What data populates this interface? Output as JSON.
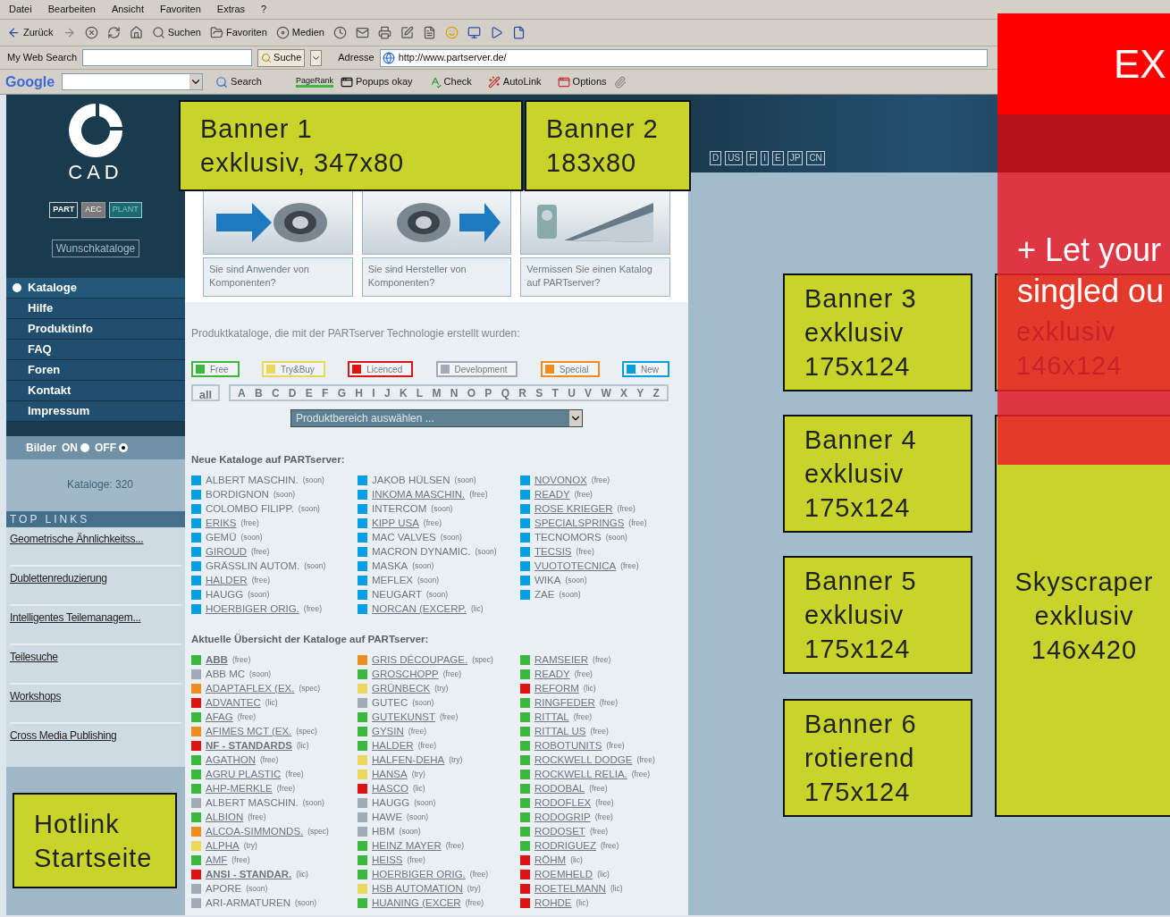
{
  "browser": {
    "menu": [
      "Datei",
      "Bearbeiten",
      "Ansicht",
      "Favoriten",
      "Extras",
      "?"
    ],
    "toolbar": [
      {
        "kind": "back",
        "label": "Zurück"
      },
      {
        "kind": "forward"
      },
      {
        "kind": "stop"
      },
      {
        "kind": "refresh"
      },
      {
        "kind": "home"
      },
      {
        "kind": "search",
        "label": "Suchen"
      },
      {
        "kind": "favorites",
        "label": "Favoriten"
      },
      {
        "kind": "media",
        "label": "Medien"
      },
      {
        "kind": "history"
      },
      {
        "kind": "mail"
      },
      {
        "kind": "print"
      },
      {
        "kind": "edit"
      },
      {
        "kind": "note"
      },
      {
        "kind": "messenger"
      },
      {
        "kind": "screen"
      },
      {
        "kind": "cursor"
      },
      {
        "kind": "file"
      }
    ],
    "search_label": "My Web Search",
    "search_button": "Suche",
    "address_label": "Adresse",
    "url": "http://www.partserver.de/",
    "google": {
      "logo": "Google",
      "search": "Search",
      "pagerank": "PageRank",
      "popups": "Popups okay",
      "check": "Check",
      "autolink": "AutoLink",
      "options": "Options"
    }
  },
  "sidebar": {
    "logo": "CAD",
    "segments": [
      {
        "label": "PART",
        "kind": "active"
      },
      {
        "label": "AEC",
        "kind": "inactive"
      },
      {
        "label": "PLANT",
        "kind": "teal"
      }
    ],
    "wish_button": "Wunschkataloge",
    "nav": [
      {
        "label": "Kataloge",
        "selected": true
      },
      {
        "label": "Hilfe",
        "selected": false
      },
      {
        "label": "Produktinfo",
        "selected": false
      },
      {
        "label": "FAQ",
        "selected": false
      },
      {
        "label": "Foren",
        "selected": false
      },
      {
        "label": "Kontakt",
        "selected": false
      },
      {
        "label": "Impressum",
        "selected": false
      }
    ],
    "images": {
      "label": "Bilder",
      "options": [
        {
          "label": "ON",
          "selected": false
        },
        {
          "label": "OFF",
          "selected": true
        }
      ]
    },
    "count": "Kataloge: 320",
    "top_links_title": "TOP LINKS",
    "top_links": [
      "Geometrische Ähnlichkeitss...",
      "Dublettenreduzierung",
      "Intelligentes Teilemanagem...",
      "Teilesuche",
      "Workshops",
      "Cross Media Publishing"
    ]
  },
  "content": {
    "audience": [
      "Sie sind Anwender von Komponenten?",
      "Sie sind Hersteller von Komponenten?",
      "Vermissen Sie einen Katalog auf PARTserver?"
    ],
    "intro": "Produktkataloge, die mit der PARTserver Technologie erstellt wurden:",
    "legend": [
      {
        "label": "Free",
        "color": "#3cb93c"
      },
      {
        "label": "Try&Buy",
        "color": "#ebd75a"
      },
      {
        "label": "Licenced",
        "color": "#dc1414"
      },
      {
        "label": "Development",
        "color": "#a0aab4"
      },
      {
        "label": "Special",
        "color": "#f08c1e"
      },
      {
        "label": "New",
        "color": "#00a0e0"
      }
    ],
    "all_button": "all",
    "letters": [
      "A",
      "B",
      "C",
      "D",
      "E",
      "F",
      "G",
      "H",
      "I",
      "J",
      "K",
      "L",
      "M",
      "N",
      "O",
      "P",
      "Q",
      "R",
      "S",
      "T",
      "U",
      "V",
      "W",
      "X",
      "Y",
      "Z"
    ],
    "category_select": {
      "placeholder": "Produktbereich auswählen ..."
    },
    "new_catalogs": {
      "title": "Neue Kataloge auf PARTserver:",
      "columns": [
        [
          {
            "name": "ALBERT MASCHIN.",
            "tag": "(soon)",
            "color": "#00a0e0",
            "link": false,
            "bold": false
          },
          {
            "name": "BORDIGNON",
            "tag": "(soon)",
            "color": "#00a0e0",
            "link": false,
            "bold": false
          },
          {
            "name": "COLOMBO FILIPP.",
            "tag": "(soon)",
            "color": "#00a0e0",
            "link": false,
            "bold": false
          },
          {
            "name": "ERIKS",
            "tag": "(free)",
            "color": "#00a0e0",
            "link": true,
            "bold": false
          },
          {
            "name": "GEMÜ",
            "tag": "(soon)",
            "color": "#00a0e0",
            "link": false,
            "bold": false
          },
          {
            "name": "GIROUD",
            "tag": "(free)",
            "color": "#00a0e0",
            "link": true,
            "bold": false
          },
          {
            "name": "GRÄSSLIN AUTOM.",
            "tag": "(soon)",
            "color": "#00a0e0",
            "link": false,
            "bold": false
          },
          {
            "name": "HALDER",
            "tag": "(free)",
            "color": "#00a0e0",
            "link": true,
            "bold": false
          },
          {
            "name": "HAUGG",
            "tag": "(soon)",
            "color": "#00a0e0",
            "link": false,
            "bold": false
          },
          {
            "name": "HOERBIGER ORIG.",
            "tag": "(free)",
            "color": "#00a0e0",
            "link": true,
            "bold": false
          }
        ],
        [
          {
            "name": "JAKOB HÜLSEN",
            "tag": "(soon)",
            "color": "#00a0e0",
            "link": false,
            "bold": false
          },
          {
            "name": "INKOMA MASCHIN.",
            "tag": "(free)",
            "color": "#00a0e0",
            "link": true,
            "bold": false
          },
          {
            "name": "INTERCOM",
            "tag": "(soon)",
            "color": "#00a0e0",
            "link": false,
            "bold": false
          },
          {
            "name": "KIPP USA",
            "tag": "(free)",
            "color": "#00a0e0",
            "link": true,
            "bold": false
          },
          {
            "name": "MAC VALVES",
            "tag": "(soon)",
            "color": "#00a0e0",
            "link": false,
            "bold": false
          },
          {
            "name": "MACRON DYNAMIC.",
            "tag": "(soon)",
            "color": "#00a0e0",
            "link": false,
            "bold": false
          },
          {
            "name": "MASKA",
            "tag": "(soon)",
            "color": "#00a0e0",
            "link": false,
            "bold": false
          },
          {
            "name": "MEFLEX",
            "tag": "(soon)",
            "color": "#00a0e0",
            "link": false,
            "bold": false
          },
          {
            "name": "NEUGART",
            "tag": "(soon)",
            "color": "#00a0e0",
            "link": false,
            "bold": false
          },
          {
            "name": "NORCAN (EXCERP.",
            "tag": "(lic)",
            "color": "#00a0e0",
            "link": true,
            "bold": false
          }
        ],
        [
          {
            "name": "NOVONOX",
            "tag": "(free)",
            "color": "#00a0e0",
            "link": true,
            "bold": false
          },
          {
            "name": "READY",
            "tag": "(free)",
            "color": "#00a0e0",
            "link": true,
            "bold": false
          },
          {
            "name": "ROSE KRIEGER",
            "tag": "(free)",
            "color": "#00a0e0",
            "link": true,
            "bold": false
          },
          {
            "name": "SPECIALSPRINGS",
            "tag": "(free)",
            "color": "#00a0e0",
            "link": true,
            "bold": false
          },
          {
            "name": "TECNOMORS",
            "tag": "(soon)",
            "color": "#00a0e0",
            "link": false,
            "bold": false
          },
          {
            "name": "TECSIS",
            "tag": "(free)",
            "color": "#00a0e0",
            "link": true,
            "bold": false
          },
          {
            "name": "VUOTOTECNICA",
            "tag": "(free)",
            "color": "#00a0e0",
            "link": true,
            "bold": false
          },
          {
            "name": "WIKA",
            "tag": "(soon)",
            "color": "#00a0e0",
            "link": false,
            "bold": false
          },
          {
            "name": "ZAE",
            "tag": "(soon)",
            "color": "#00a0e0",
            "link": false,
            "bold": false
          }
        ]
      ]
    },
    "overview": {
      "title": "Aktuelle Übersicht der Kataloge auf PARTserver:",
      "columns": [
        [
          {
            "name": "ABB",
            "tag": "(free)",
            "color": "#3cb93c",
            "link": true,
            "bold": true
          },
          {
            "name": "ABB MC",
            "tag": "(soon)",
            "color": "#a0aab4",
            "link": false,
            "bold": false
          },
          {
            "name": "ADAPTAFLEX (EX.",
            "tag": "(spec)",
            "color": "#f08c1e",
            "link": true,
            "bold": false
          },
          {
            "name": "ADVANTEC",
            "tag": "(lic)",
            "color": "#dc1414",
            "link": true,
            "bold": false
          },
          {
            "name": "AFAG",
            "tag": "(free)",
            "color": "#3cb93c",
            "link": true,
            "bold": false
          },
          {
            "name": "AFIMES MCT (EX.",
            "tag": "(spec)",
            "color": "#f08c1e",
            "link": true,
            "bold": false
          },
          {
            "name": "NF - STANDARDS",
            "tag": "(lic)",
            "color": "#dc1414",
            "link": true,
            "bold": true
          },
          {
            "name": "AGATHON",
            "tag": "(free)",
            "color": "#3cb93c",
            "link": true,
            "bold": false
          },
          {
            "name": "AGRU PLASTIC",
            "tag": "(free)",
            "color": "#3cb93c",
            "link": true,
            "bold": false
          },
          {
            "name": "AHP-MERKLE",
            "tag": "(free)",
            "color": "#3cb93c",
            "link": true,
            "bold": false
          },
          {
            "name": "ALBERT MASCHIN.",
            "tag": "(soon)",
            "color": "#a0aab4",
            "link": false,
            "bold": false
          },
          {
            "name": "ALBION",
            "tag": "(free)",
            "color": "#3cb93c",
            "link": true,
            "bold": false
          },
          {
            "name": "ALCOA-SIMMONDS.",
            "tag": "(spec)",
            "color": "#f08c1e",
            "link": true,
            "bold": false
          },
          {
            "name": "ALPHA",
            "tag": "(try)",
            "color": "#ebd75a",
            "link": true,
            "bold": false
          },
          {
            "name": "AMF",
            "tag": "(free)",
            "color": "#3cb93c",
            "link": true,
            "bold": false
          },
          {
            "name": "ANSI - STANDAR.",
            "tag": "(lic)",
            "color": "#dc1414",
            "link": true,
            "bold": true
          },
          {
            "name": "APORE",
            "tag": "(soon)",
            "color": "#a0aab4",
            "link": false,
            "bold": false
          },
          {
            "name": "ARI-ARMATUREN",
            "tag": "(soon)",
            "color": "#a0aab4",
            "link": false,
            "bold": false
          }
        ],
        [
          {
            "name": "GRIS DÉCOUPAGE.",
            "tag": "(spec)",
            "color": "#f08c1e",
            "link": true,
            "bold": false
          },
          {
            "name": "GROSCHOPP",
            "tag": "(free)",
            "color": "#3cb93c",
            "link": true,
            "bold": false
          },
          {
            "name": "GRÜNBECK",
            "tag": "(try)",
            "color": "#ebd75a",
            "link": true,
            "bold": false
          },
          {
            "name": "GUTEC",
            "tag": "(soon)",
            "color": "#a0aab4",
            "link": false,
            "bold": false
          },
          {
            "name": "GUTEKUNST",
            "tag": "(free)",
            "color": "#3cb93c",
            "link": true,
            "bold": false
          },
          {
            "name": "GYSIN",
            "tag": "(free)",
            "color": "#3cb93c",
            "link": true,
            "bold": false
          },
          {
            "name": "HALDER",
            "tag": "(free)",
            "color": "#3cb93c",
            "link": true,
            "bold": false
          },
          {
            "name": "HALFEN-DEHA",
            "tag": "(try)",
            "color": "#ebd75a",
            "link": true,
            "bold": false
          },
          {
            "name": "HANSA",
            "tag": "(try)",
            "color": "#ebd75a",
            "link": true,
            "bold": false
          },
          {
            "name": "HASCO",
            "tag": "(lic)",
            "color": "#dc1414",
            "link": true,
            "bold": false
          },
          {
            "name": "HAUGG",
            "tag": "(soon)",
            "color": "#a0aab4",
            "link": false,
            "bold": false
          },
          {
            "name": "HAWE",
            "tag": "(soon)",
            "color": "#a0aab4",
            "link": false,
            "bold": false
          },
          {
            "name": "HBM",
            "tag": "(soon)",
            "color": "#a0aab4",
            "link": false,
            "bold": false
          },
          {
            "name": "HEINZ MAYER",
            "tag": "(free)",
            "color": "#3cb93c",
            "link": true,
            "bold": false
          },
          {
            "name": "HEISS",
            "tag": "(free)",
            "color": "#3cb93c",
            "link": true,
            "bold": false
          },
          {
            "name": "HOERBIGER ORIG.",
            "tag": "(free)",
            "color": "#3cb93c",
            "link": true,
            "bold": false
          },
          {
            "name": "HSB AUTOMATION",
            "tag": "(try)",
            "color": "#ebd75a",
            "link": true,
            "bold": false
          },
          {
            "name": "HUANING (EXCER",
            "tag": "(free)",
            "color": "#3cb93c",
            "link": true,
            "bold": false
          }
        ],
        [
          {
            "name": "RAMSEIER",
            "tag": "(free)",
            "color": "#3cb93c",
            "link": true,
            "bold": false
          },
          {
            "name": "READY",
            "tag": "(free)",
            "color": "#3cb93c",
            "link": true,
            "bold": false
          },
          {
            "name": "REFORM",
            "tag": "(lic)",
            "color": "#dc1414",
            "link": true,
            "bold": false
          },
          {
            "name": "RINGFEDER",
            "tag": "(free)",
            "color": "#3cb93c",
            "link": true,
            "bold": false
          },
          {
            "name": "RITTAL",
            "tag": "(free)",
            "color": "#3cb93c",
            "link": true,
            "bold": false
          },
          {
            "name": "RITTAL US",
            "tag": "(free)",
            "color": "#3cb93c",
            "link": true,
            "bold": false
          },
          {
            "name": "ROBOTUNITS",
            "tag": "(free)",
            "color": "#3cb93c",
            "link": true,
            "bold": false
          },
          {
            "name": "ROCKWELL DODGE",
            "tag": "(free)",
            "color": "#3cb93c",
            "link": true,
            "bold": false
          },
          {
            "name": "ROCKWELL RELIA.",
            "tag": "(free)",
            "color": "#3cb93c",
            "link": true,
            "bold": false
          },
          {
            "name": "RODOBAL",
            "tag": "(free)",
            "color": "#3cb93c",
            "link": true,
            "bold": false
          },
          {
            "name": "RODOFLEX",
            "tag": "(free)",
            "color": "#3cb93c",
            "link": true,
            "bold": false
          },
          {
            "name": "RODOGRIP",
            "tag": "(free)",
            "color": "#3cb93c",
            "link": true,
            "bold": false
          },
          {
            "name": "RODOSET",
            "tag": "(free)",
            "color": "#3cb93c",
            "link": true,
            "bold": false
          },
          {
            "name": "RODRIGUEZ",
            "tag": "(free)",
            "color": "#3cb93c",
            "link": true,
            "bold": false
          },
          {
            "name": "RÖHM",
            "tag": "(lic)",
            "color": "#dc1414",
            "link": true,
            "bold": false
          },
          {
            "name": "ROEMHELD",
            "tag": "(lic)",
            "color": "#dc1414",
            "link": true,
            "bold": false
          },
          {
            "name": "ROETELMANN",
            "tag": "(lic)",
            "color": "#dc1414",
            "link": true,
            "bold": false
          },
          {
            "name": "ROHDE",
            "tag": "(lic)",
            "color": "#dc1414",
            "link": true,
            "bold": false
          }
        ]
      ]
    }
  },
  "languages": [
    "D",
    "US",
    "F",
    "I",
    "E",
    "JP",
    "CN"
  ],
  "banners": [
    {
      "lines": [
        "Banner 1",
        "exklusiv, 347x80"
      ]
    },
    {
      "lines": [
        "Banner 2",
        "183x80"
      ]
    },
    {
      "lines": [
        "Banner 3",
        "exklusiv",
        "175x124"
      ]
    },
    {
      "lines": [
        "Banner 4",
        "exklusiv",
        "175x124"
      ]
    },
    {
      "lines": [
        "Banner 5",
        "exklusiv",
        "175x124"
      ]
    },
    {
      "lines": [
        "Banner 6",
        "rotierend",
        "175x124"
      ]
    },
    {
      "lines": [
        "exklusiv",
        "146x124"
      ]
    },
    {
      "lines": [
        "Skyscraper",
        "exklusiv",
        "146x420"
      ]
    },
    {
      "lines": [
        "Hotlink",
        "Startseite"
      ]
    }
  ],
  "overlay": {
    "heading": "EX",
    "lines": [
      "+ Let your",
      "singled ou"
    ]
  }
}
